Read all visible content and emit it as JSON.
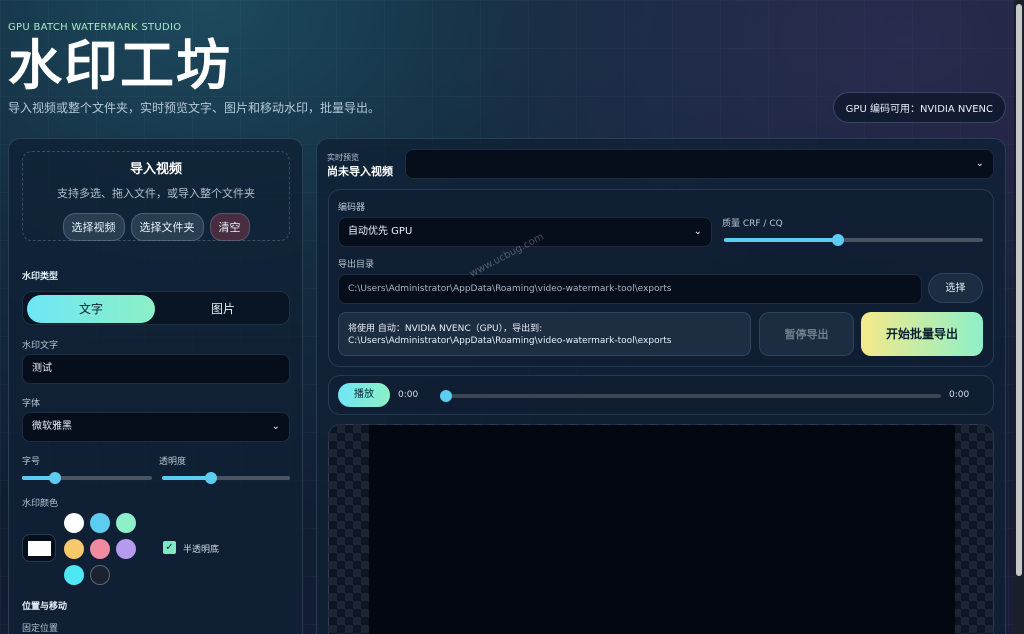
{
  "header": {
    "eyebrow": "GPU BATCH WATERMARK STUDIO",
    "title": "水印工坊",
    "subtitle": "导入视频或整个文件夹，实时预览文字、图片和移动水印，批量导出。",
    "gpu_badge": "GPU 编码可用：NVIDIA NVENC"
  },
  "import": {
    "title": "导入视频",
    "desc": "支持多选、拖入文件，或导入整个文件夹",
    "select_videos": "选择视频",
    "select_folder": "选择文件夹",
    "clear": "清空"
  },
  "watermark": {
    "type_label": "水印类型",
    "type_text": "文字",
    "type_image": "图片",
    "text_label": "水印文字",
    "text_value": "测试",
    "font_label": "字体",
    "font_value": "微软雅黑",
    "size_label": "字号",
    "size_value": 0.25,
    "opacity_label": "透明度",
    "opacity_value": 0.38,
    "color_label": "水印颜色",
    "colors": [
      "#ffffff",
      "#5ccdf0",
      "#8ef0c8",
      "#f6c96a",
      "#f08aa0",
      "#b59af0",
      "#4ee8f5",
      "#1c2230"
    ],
    "selected_color": "#ffffff",
    "semi_transparent_label": "半透明底",
    "semi_transparent_checked": true,
    "position_label": "位置与移动",
    "fixed_position_label": "固定位置"
  },
  "preview": {
    "label_small": "实时预览",
    "label_title": "尚未导入视频",
    "select_value": ""
  },
  "encoder": {
    "label": "编码器",
    "value": "自动优先 GPU",
    "quality_label": "质量 CRF / CQ",
    "quality_value": 0.44,
    "export_dir_label": "导出目录",
    "export_dir_value": "C:\\Users\\Administrator\\AppData\\Roaming\\video-watermark-tool\\exports",
    "choose_button": "选择",
    "status_line1": "将使用 自动：NVIDIA NVENC（GPU），导出到:",
    "status_line2": "C:\\Users\\Administrator\\AppData\\Roaming\\video-watermark-tool\\exports",
    "pause_button": "暂停导出",
    "start_button": "开始批量导出"
  },
  "player": {
    "play_button": "播放",
    "current_time": "0:00",
    "duration": "0:00",
    "progress": 0
  },
  "overlay_watermark": "www.ucbug.com"
}
